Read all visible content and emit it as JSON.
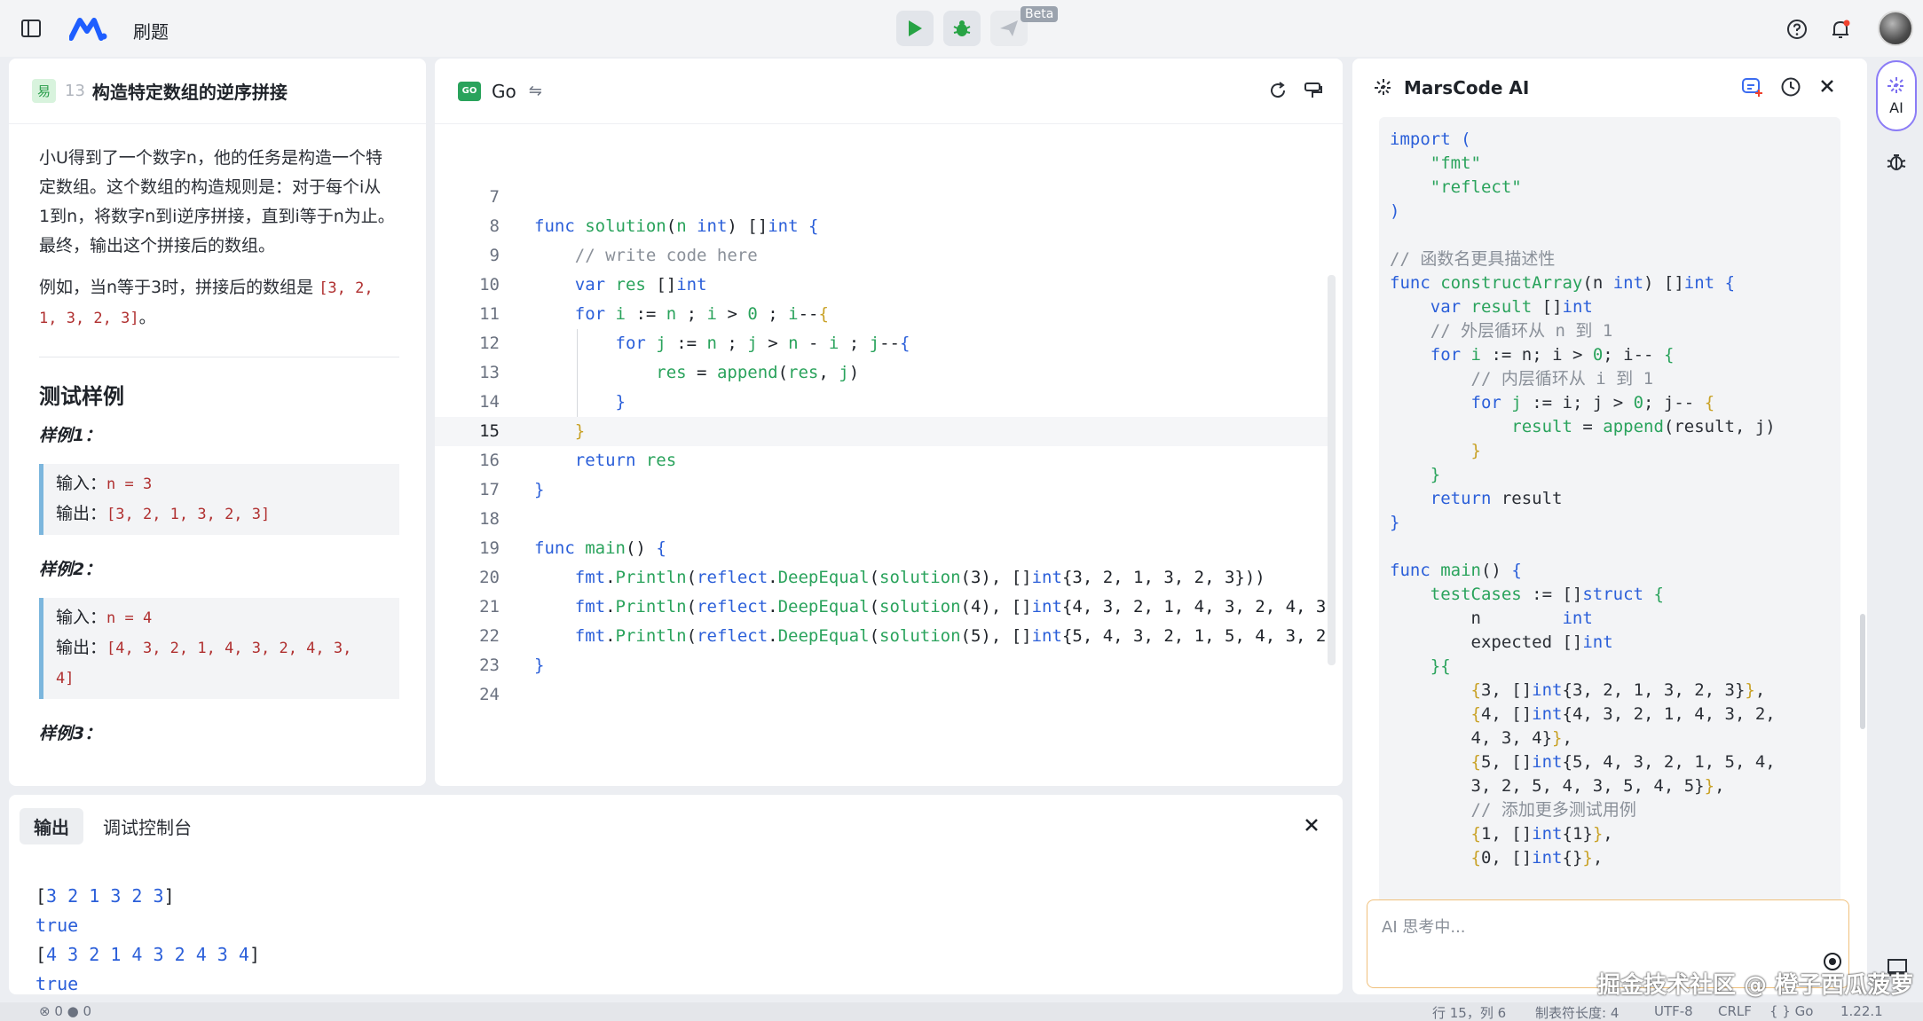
{
  "topbar": {
    "title": "刷题",
    "beta_badge": "Beta"
  },
  "problem": {
    "difficulty": "易",
    "number": "13",
    "title": "构造特定数组的逆序拼接",
    "desc_lines": [
      "小U得到了一个数字n，他的任务是构造一个特",
      "定数组。这个数组的构造规则是：对于每个i从",
      "1到n，将数字n到i逆序拼接，直到i等于n为止。",
      "最终，输出这个拼接后的数组。"
    ],
    "example_prefix": "例如，当n等于3时，拼接后的数组是",
    "example_code_1": "[3, 2,",
    "example_code_2": "1, 3, 2, 3]",
    "example_suffix": "。",
    "tests_heading": "测试样例",
    "samples": [
      {
        "label": "样例1：",
        "input_label": "输入：",
        "input": "n = 3",
        "output_label": "输出：",
        "output": "[3, 2, 1, 3, 2, 3]",
        "output_cont": ""
      },
      {
        "label": "样例2：",
        "input_label": "输入：",
        "input": "n = 4",
        "output_label": "输出：",
        "output": "[4, 3, 2, 1, 4, 3, 2, 4, 3,",
        "output_cont": "4]"
      },
      {
        "label": "样例3：",
        "input_label": "",
        "input": "",
        "output_label": "",
        "output": "",
        "output_cont": ""
      }
    ]
  },
  "editor": {
    "language": "Go",
    "active_line": 15
  },
  "ai": {
    "title": "MarsCode AI",
    "input_placeholder": "AI 思考中...",
    "rail_label": "AI"
  },
  "output": {
    "tabs": [
      "输出",
      "调试控制台"
    ],
    "lines": [
      "[3 2 1 3 2 3]",
      "true",
      "[4 3 2 1 4 3 2 4 3 4]",
      "true"
    ]
  },
  "status": {
    "errors": "0",
    "warnings": "0",
    "position": "行 15，列 6",
    "tab_size": "制表符长度: 4",
    "encoding": "UTF-8",
    "eol": "CRLF",
    "lang": "{ } Go",
    "version": "1.22.1"
  },
  "watermark": "掘金技术社区 @ 橙子西瓜菠萝",
  "colors": {
    "keyword": "#2b5fd9",
    "function": "#2aa35c",
    "comment": "#8a9099",
    "ai_accent": "#8b7cf6",
    "run_green": "#27a344"
  }
}
